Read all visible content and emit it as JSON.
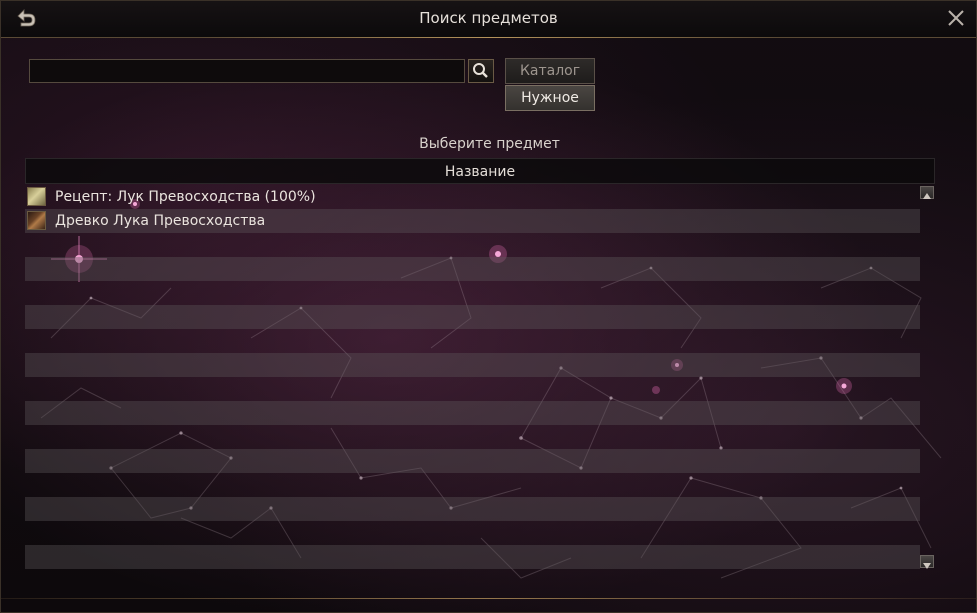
{
  "window": {
    "title": "Поиск предметов"
  },
  "search": {
    "value": "",
    "placeholder": ""
  },
  "tabs": {
    "catalog_label": "Каталог",
    "needed_label": "Нужное",
    "selected": "Нужное"
  },
  "list": {
    "hint": "Выберите предмет",
    "column_header": "Название",
    "items": [
      {
        "name": "Рецепт: Лук Превосходства (100%)",
        "icon": "recipe-scroll-icon"
      },
      {
        "name": "Древко Лука Превосходства",
        "icon": "bow-shaft-icon"
      }
    ]
  },
  "colors": {
    "accent_gold": "#b8955f",
    "background": "#120c11",
    "row_stripe": "#5f5a5c"
  }
}
